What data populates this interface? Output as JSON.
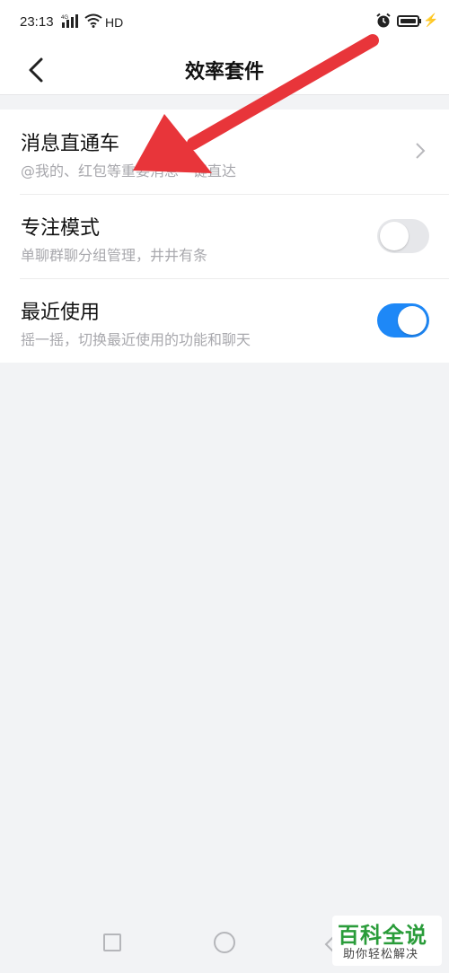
{
  "status_bar": {
    "time": "23:13",
    "network_label": "4G",
    "hd_label": "HD"
  },
  "header": {
    "title": "效率套件"
  },
  "settings": [
    {
      "title": "消息直通车",
      "subtitle": "@我的、红包等重要消息一键直达",
      "control": "chevron"
    },
    {
      "title": "专注模式",
      "subtitle": "单聊群聊分组管理，井井有条",
      "control": "toggle",
      "enabled": false
    },
    {
      "title": "最近使用",
      "subtitle": "摇一摇，切换最近使用的功能和聊天",
      "control": "toggle",
      "enabled": true
    }
  ],
  "colors": {
    "accent": "#1e88f7",
    "annotation_arrow": "#e8353a",
    "watermark_green": "#2a9c3a"
  },
  "watermark": {
    "main": "百科全说",
    "sub": "助你轻松解决"
  }
}
